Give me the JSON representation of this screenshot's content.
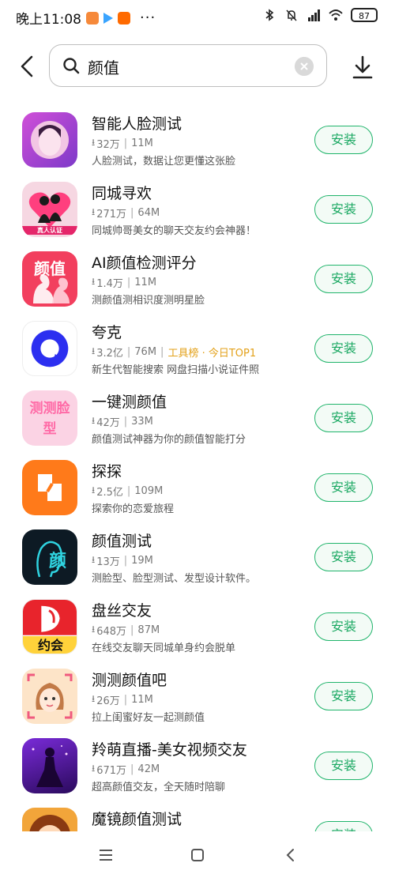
{
  "status": {
    "time": "晚上11:08",
    "dots": "···",
    "battery": "87"
  },
  "search": {
    "query": "颜值"
  },
  "install_label": "安装",
  "apps": [
    {
      "name": "智能人脸测试",
      "downloads": "32万",
      "size": "11M",
      "tag": "",
      "desc": "人脸测试，数据让您更懂这张脸"
    },
    {
      "name": "同城寻欢",
      "downloads": "271万",
      "size": "64M",
      "tag": "",
      "desc": "同城帅哥美女的聊天交友约会神器！",
      "icon_text": "真人认证"
    },
    {
      "name": "AI颜值检测评分",
      "downloads": "1.4万",
      "size": "11M",
      "tag": "",
      "desc": "测颜值测相识度测明星脸",
      "icon_text": "颜值"
    },
    {
      "name": "夸克",
      "downloads": "3.2亿",
      "size": "76M",
      "tag": "工具榜 · 今日TOP1",
      "desc": "新生代智能搜索 网盘扫描小说证件照"
    },
    {
      "name": "一键测颜值",
      "downloads": "42万",
      "size": "33M",
      "tag": "",
      "desc": "颜值测试神器为你的颜值智能打分",
      "icon_text": "测测脸型"
    },
    {
      "name": "探探",
      "downloads": "2.5亿",
      "size": "109M",
      "tag": "",
      "desc": "探索你的恋爱旅程"
    },
    {
      "name": "颜值测试",
      "downloads": "13万",
      "size": "19M",
      "tag": "",
      "desc": "测脸型、脸型测试、发型设计软件。",
      "icon_text": "颜"
    },
    {
      "name": "盘丝交友",
      "downloads": "648万",
      "size": "87M",
      "tag": "",
      "desc": "在线交友聊天同城单身约会脱单",
      "icon_text": "约会"
    },
    {
      "name": "测测颜值吧",
      "downloads": "26万",
      "size": "11M",
      "tag": "",
      "desc": "拉上闺蜜好友一起测颜值"
    },
    {
      "name": "羚萌直播-美女视频交友",
      "downloads": "671万",
      "size": "42M",
      "tag": "",
      "desc": "超高颜值交友，全天随时陪聊"
    },
    {
      "name": "魔镜颜值测试",
      "downloads": "",
      "size": "",
      "tag": "",
      "desc": ""
    }
  ],
  "colors": {
    "accent": "#1aa862",
    "tag": "#e3a11a"
  }
}
